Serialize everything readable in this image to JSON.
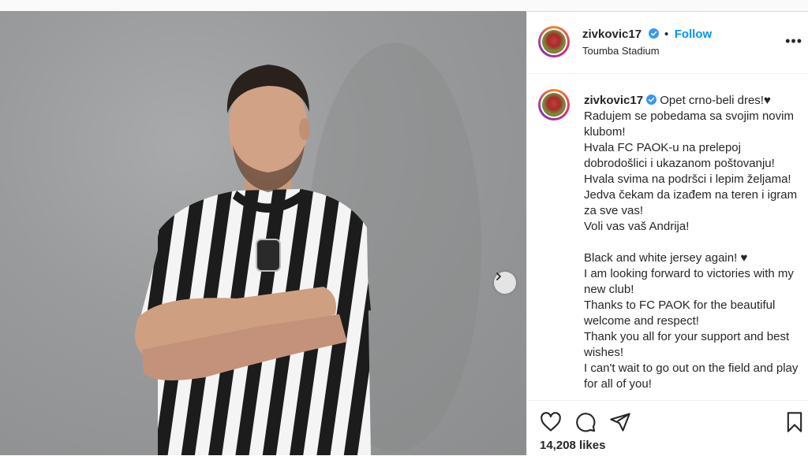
{
  "post": {
    "username": "zivkovic17",
    "follow_label": "Follow",
    "location": "Toumba Stadium",
    "more_icon": "more-options-icon",
    "caption": {
      "username": "zivkovic17",
      "text": "Opet crno-beli dres!♥\nRadujem se pobedama sa svojim novim klubom!\nHvala FC PAOK-u na prelepoj dobrodošlici i ukazanom poštovanju!\nHvala svima na podršci i lepim željama!\nJedva čekam da izađem na teren i igram za sve vas!\nVoli vas vaš Andrija!\n\nBlack and white jersey again! ♥\nI am looking forward to victories with my new club!\nThanks to FC PAOK for the beautiful welcome and respect!\nThank you all for your support and best wishes!\nI can't wait to go out on the field and play for all of you!"
    },
    "likes": "14,208 likes",
    "icons": {
      "like": "heart-icon",
      "comment": "comment-icon",
      "share": "share-icon",
      "save": "bookmark-icon",
      "next": "chevron-right-icon",
      "verified": "verified-badge-icon"
    },
    "colors": {
      "follow": "#0095f6",
      "verified": "#3897f0",
      "text": "#262626"
    }
  }
}
